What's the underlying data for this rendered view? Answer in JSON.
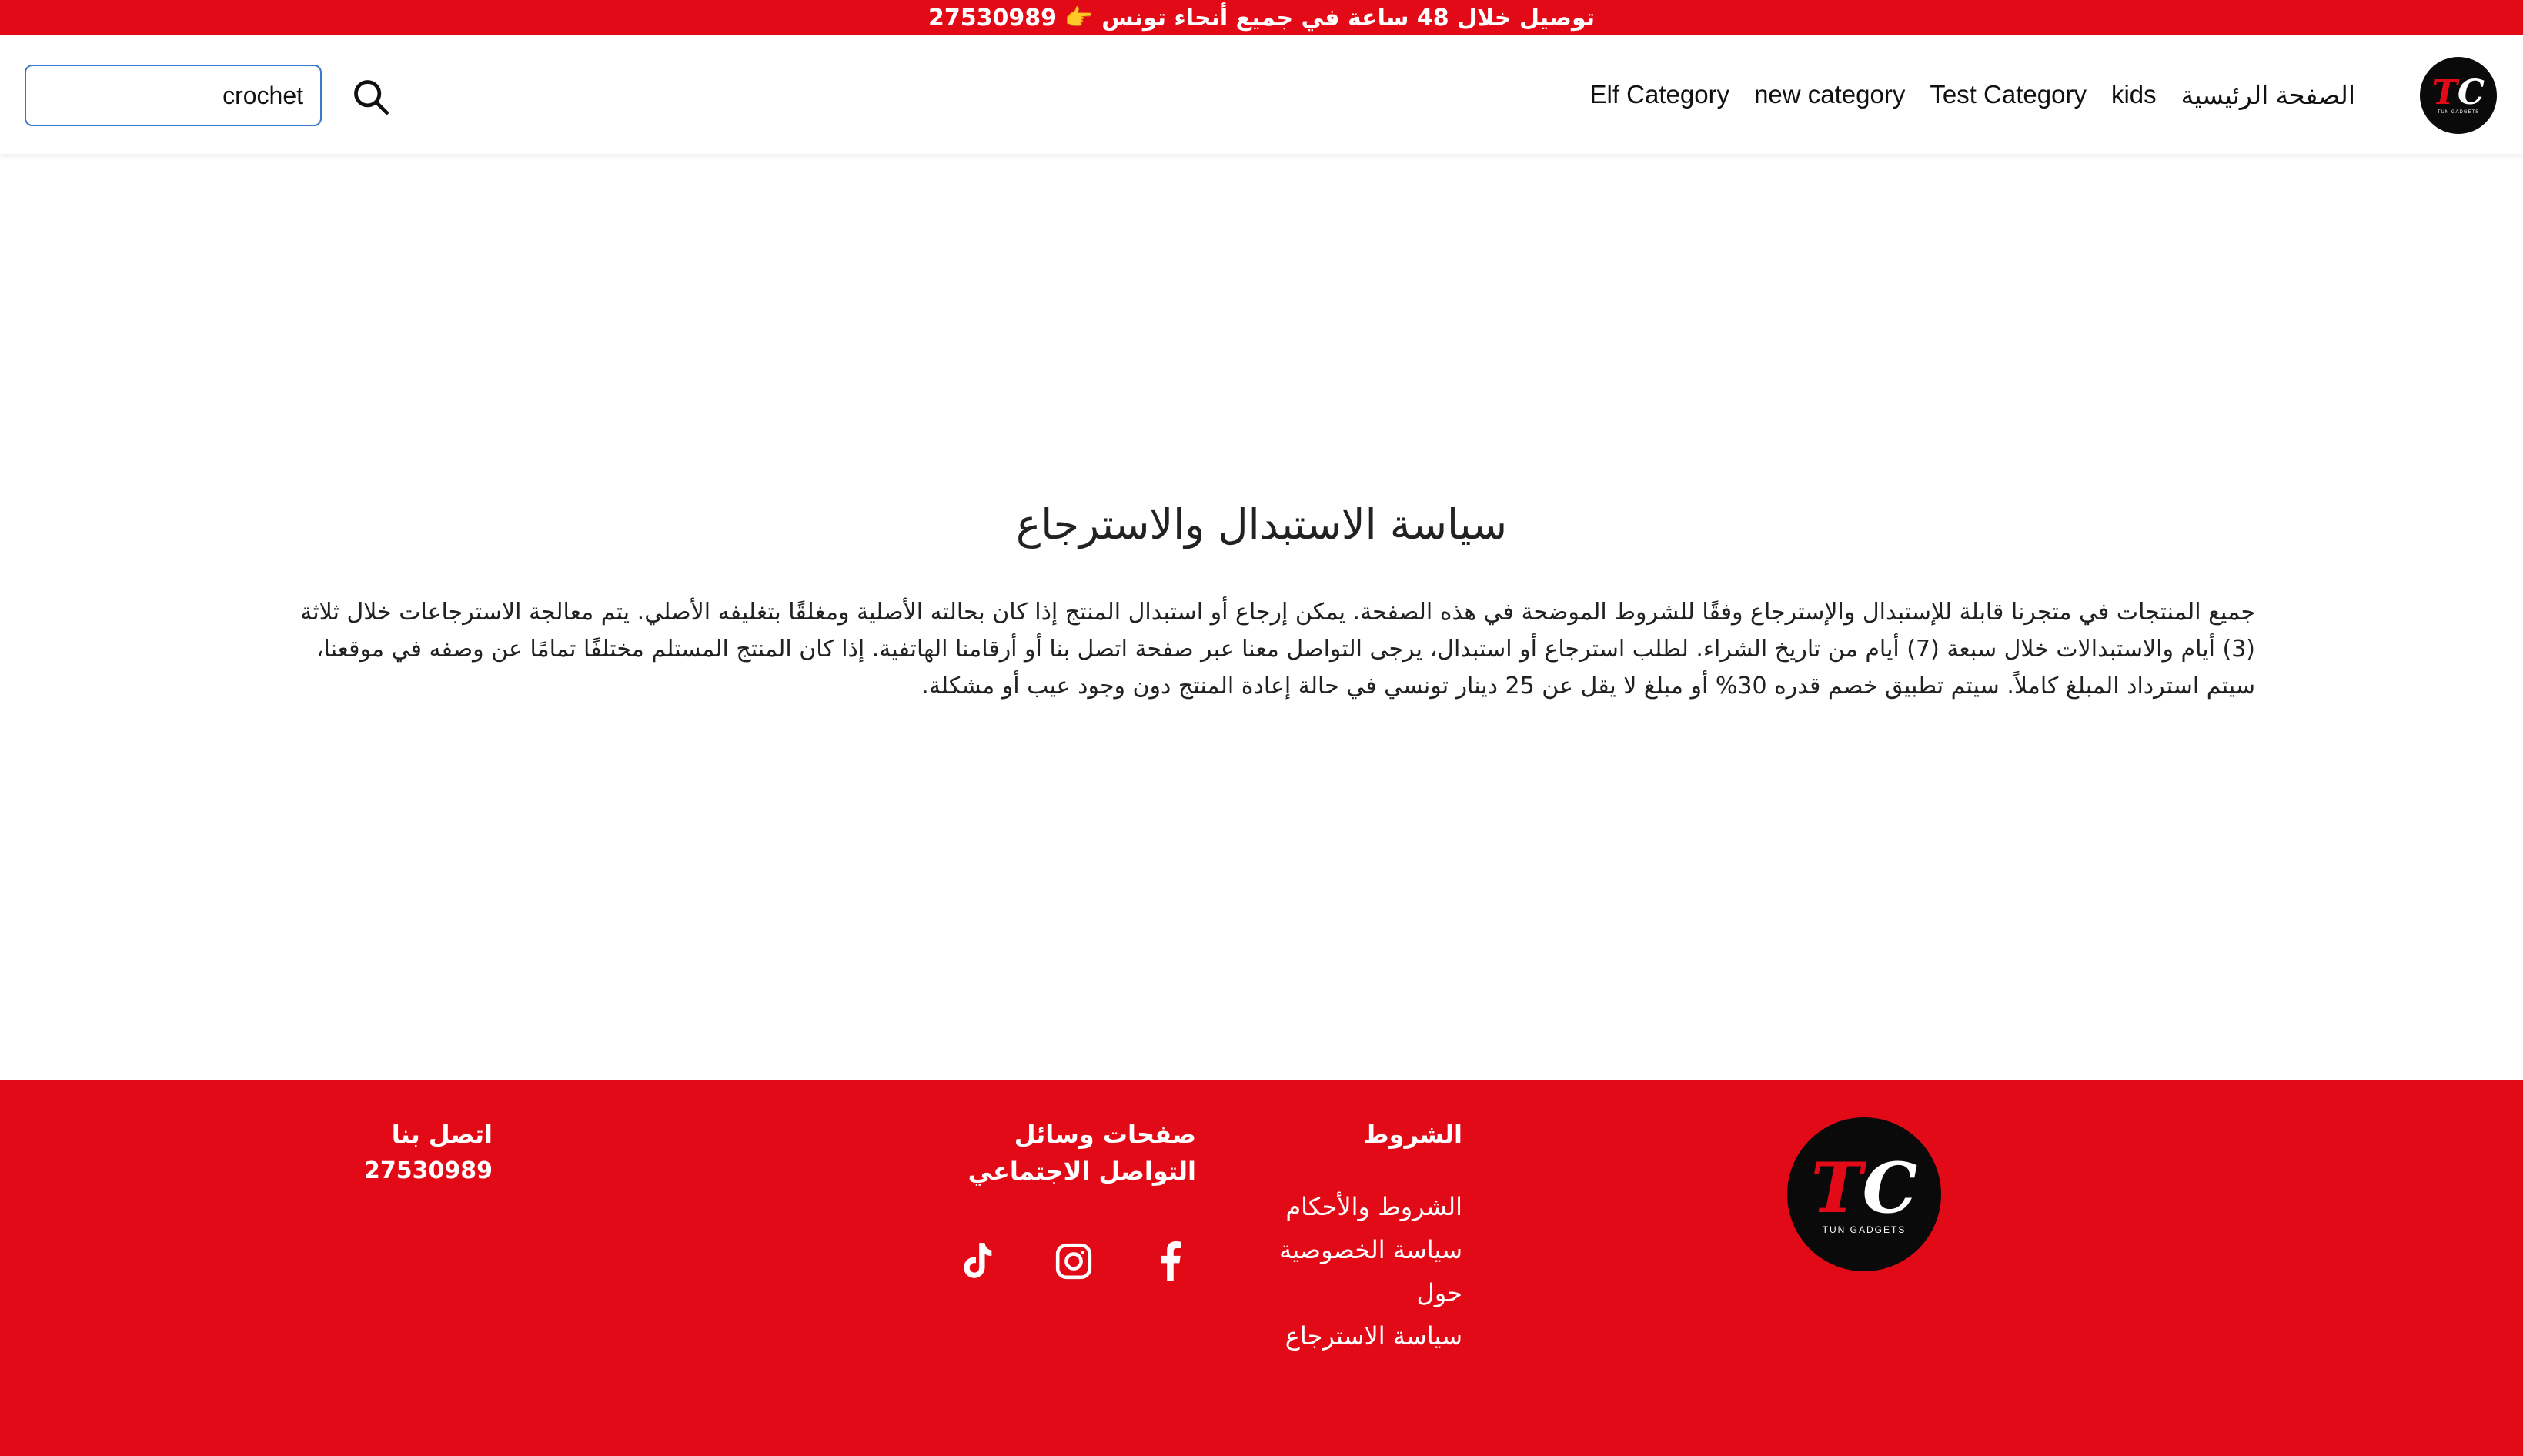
{
  "colors": {
    "brand_red": "#e30a17",
    "logo_bg": "#0a0a0a",
    "input_border": "#3a78c9"
  },
  "announcement": {
    "text": "توصيل خلال 48 ساعة في جميع أنحاء تونس 👉 27530989"
  },
  "search": {
    "value": "crochet",
    "icon": "search-icon"
  },
  "nav": {
    "items": [
      {
        "label": "الصفحة الرئيسية"
      },
      {
        "label": "kids"
      },
      {
        "label": "Test Category"
      },
      {
        "label": "new category"
      },
      {
        "label": "Elf Category"
      }
    ]
  },
  "logo": {
    "monogram_t": "T",
    "monogram_c": "C",
    "brand": "TUN GADGETS"
  },
  "main": {
    "title": "سياسة الاستبدال والاسترجاع",
    "body": "جميع المنتجات في متجرنا قابلة للإستبدال والإسترجاع وفقًا للشروط الموضحة في هذه الصفحة. يمكن إرجاع أو استبدال المنتج إذا كان بحالته الأصلية ومغلقًا بتغليفه الأصلي. يتم معالجة الاسترجاعات خلال ثلاثة (3) أيام والاستبدالات خلال سبعة (7) أيام من تاريخ الشراء. لطلب استرجاع أو استبدال، يرجى التواصل معنا عبر صفحة اتصل بنا أو أرقامنا الهاتفية. إذا كان المنتج المستلم مختلفًا تمامًا عن وصفه في موقعنا، سيتم استرداد المبلغ كاملاً. سيتم تطبيق خصم قدره 30% أو مبلغ لا يقل عن 25 دينار تونسي في حالة إعادة المنتج دون وجود عيب أو مشكلة."
  },
  "footer": {
    "terms": {
      "heading": "الشروط",
      "links": [
        {
          "label": "الشروط والأحكام"
        },
        {
          "label": "سياسة الخصوصية"
        },
        {
          "label": "حول"
        },
        {
          "label": "سياسة الاسترجاع"
        }
      ]
    },
    "social": {
      "heading": "صفحات وسائل التواصل الاجتماعي",
      "icons": [
        "facebook-icon",
        "instagram-icon",
        "tiktok-icon"
      ]
    },
    "contact": {
      "heading": "اتصل بنا",
      "phone": "27530989"
    }
  }
}
